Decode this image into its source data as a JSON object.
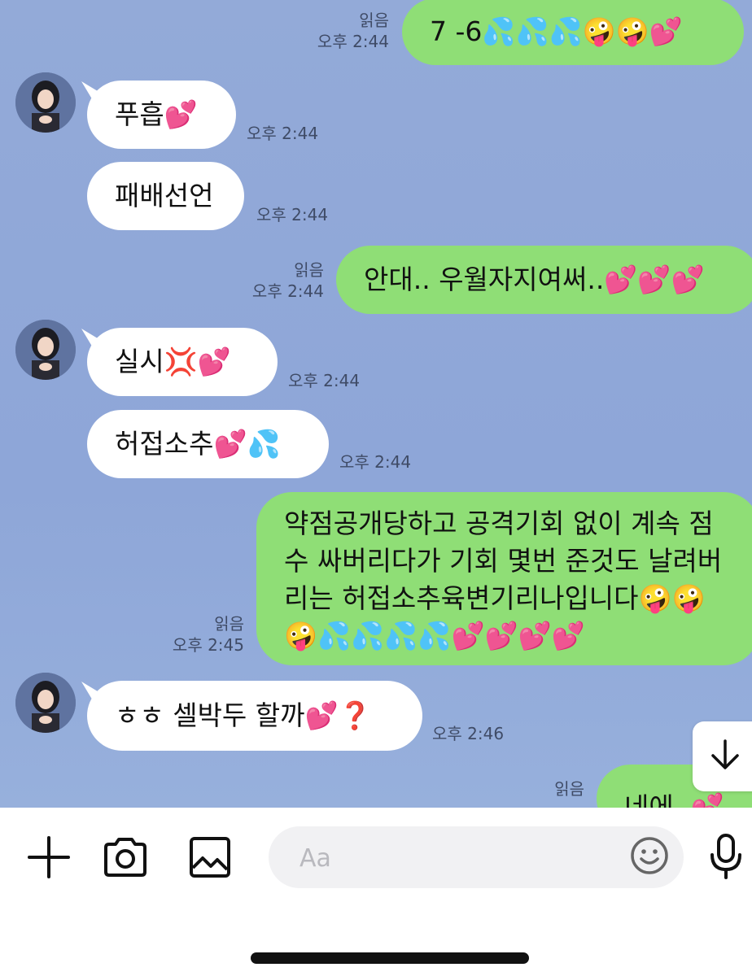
{
  "colors": {
    "chat_background": "#8fa6d6",
    "incoming_bubble": "#ffffff",
    "outgoing_bubble": "#8fde76",
    "meta_text": "#3f4b66"
  },
  "messages": [
    {
      "direction": "out",
      "text": "7 -6💦💦💦🤪🤪💕",
      "read": "읽음",
      "time": "오후 2:44"
    },
    {
      "direction": "in",
      "text": "푸흡💕",
      "time": "오후 2:44"
    },
    {
      "direction": "in",
      "text": "패배선언",
      "time": "오후 2:44"
    },
    {
      "direction": "out",
      "text": "안대.. 우월자지여써..💕💕💕",
      "read": "읽음",
      "time": "오후 2:44"
    },
    {
      "direction": "in",
      "text": "실시💢💕",
      "time": "오후 2:44"
    },
    {
      "direction": "in",
      "text": "허접소추💕💦",
      "time": "오후 2:44"
    },
    {
      "direction": "out",
      "lines": [
        "약점공개당하고 공격기회 없이 계속 점",
        "수 싸버리다가 기회 몇번 준것도 날려버",
        "리는 허접소추육변기리나입니다🤪🤪",
        "🤪💦💦💦💦💕💕💕💕"
      ],
      "read": "읽음",
      "time": "오후 2:45"
    },
    {
      "direction": "in",
      "text": "ㅎㅎ 셀박두 할까💕❓",
      "time": "오후 2:46"
    },
    {
      "direction": "out",
      "text": "네에..💕",
      "read": "읽음"
    }
  ],
  "composer": {
    "add_icon": "plus-icon",
    "camera_icon": "camera-icon",
    "gallery_icon": "image-icon",
    "placeholder": "Aa",
    "emoji_icon": "smiley-icon",
    "mic_icon": "microphone-icon"
  },
  "scroll_button_icon": "arrow-down-icon"
}
